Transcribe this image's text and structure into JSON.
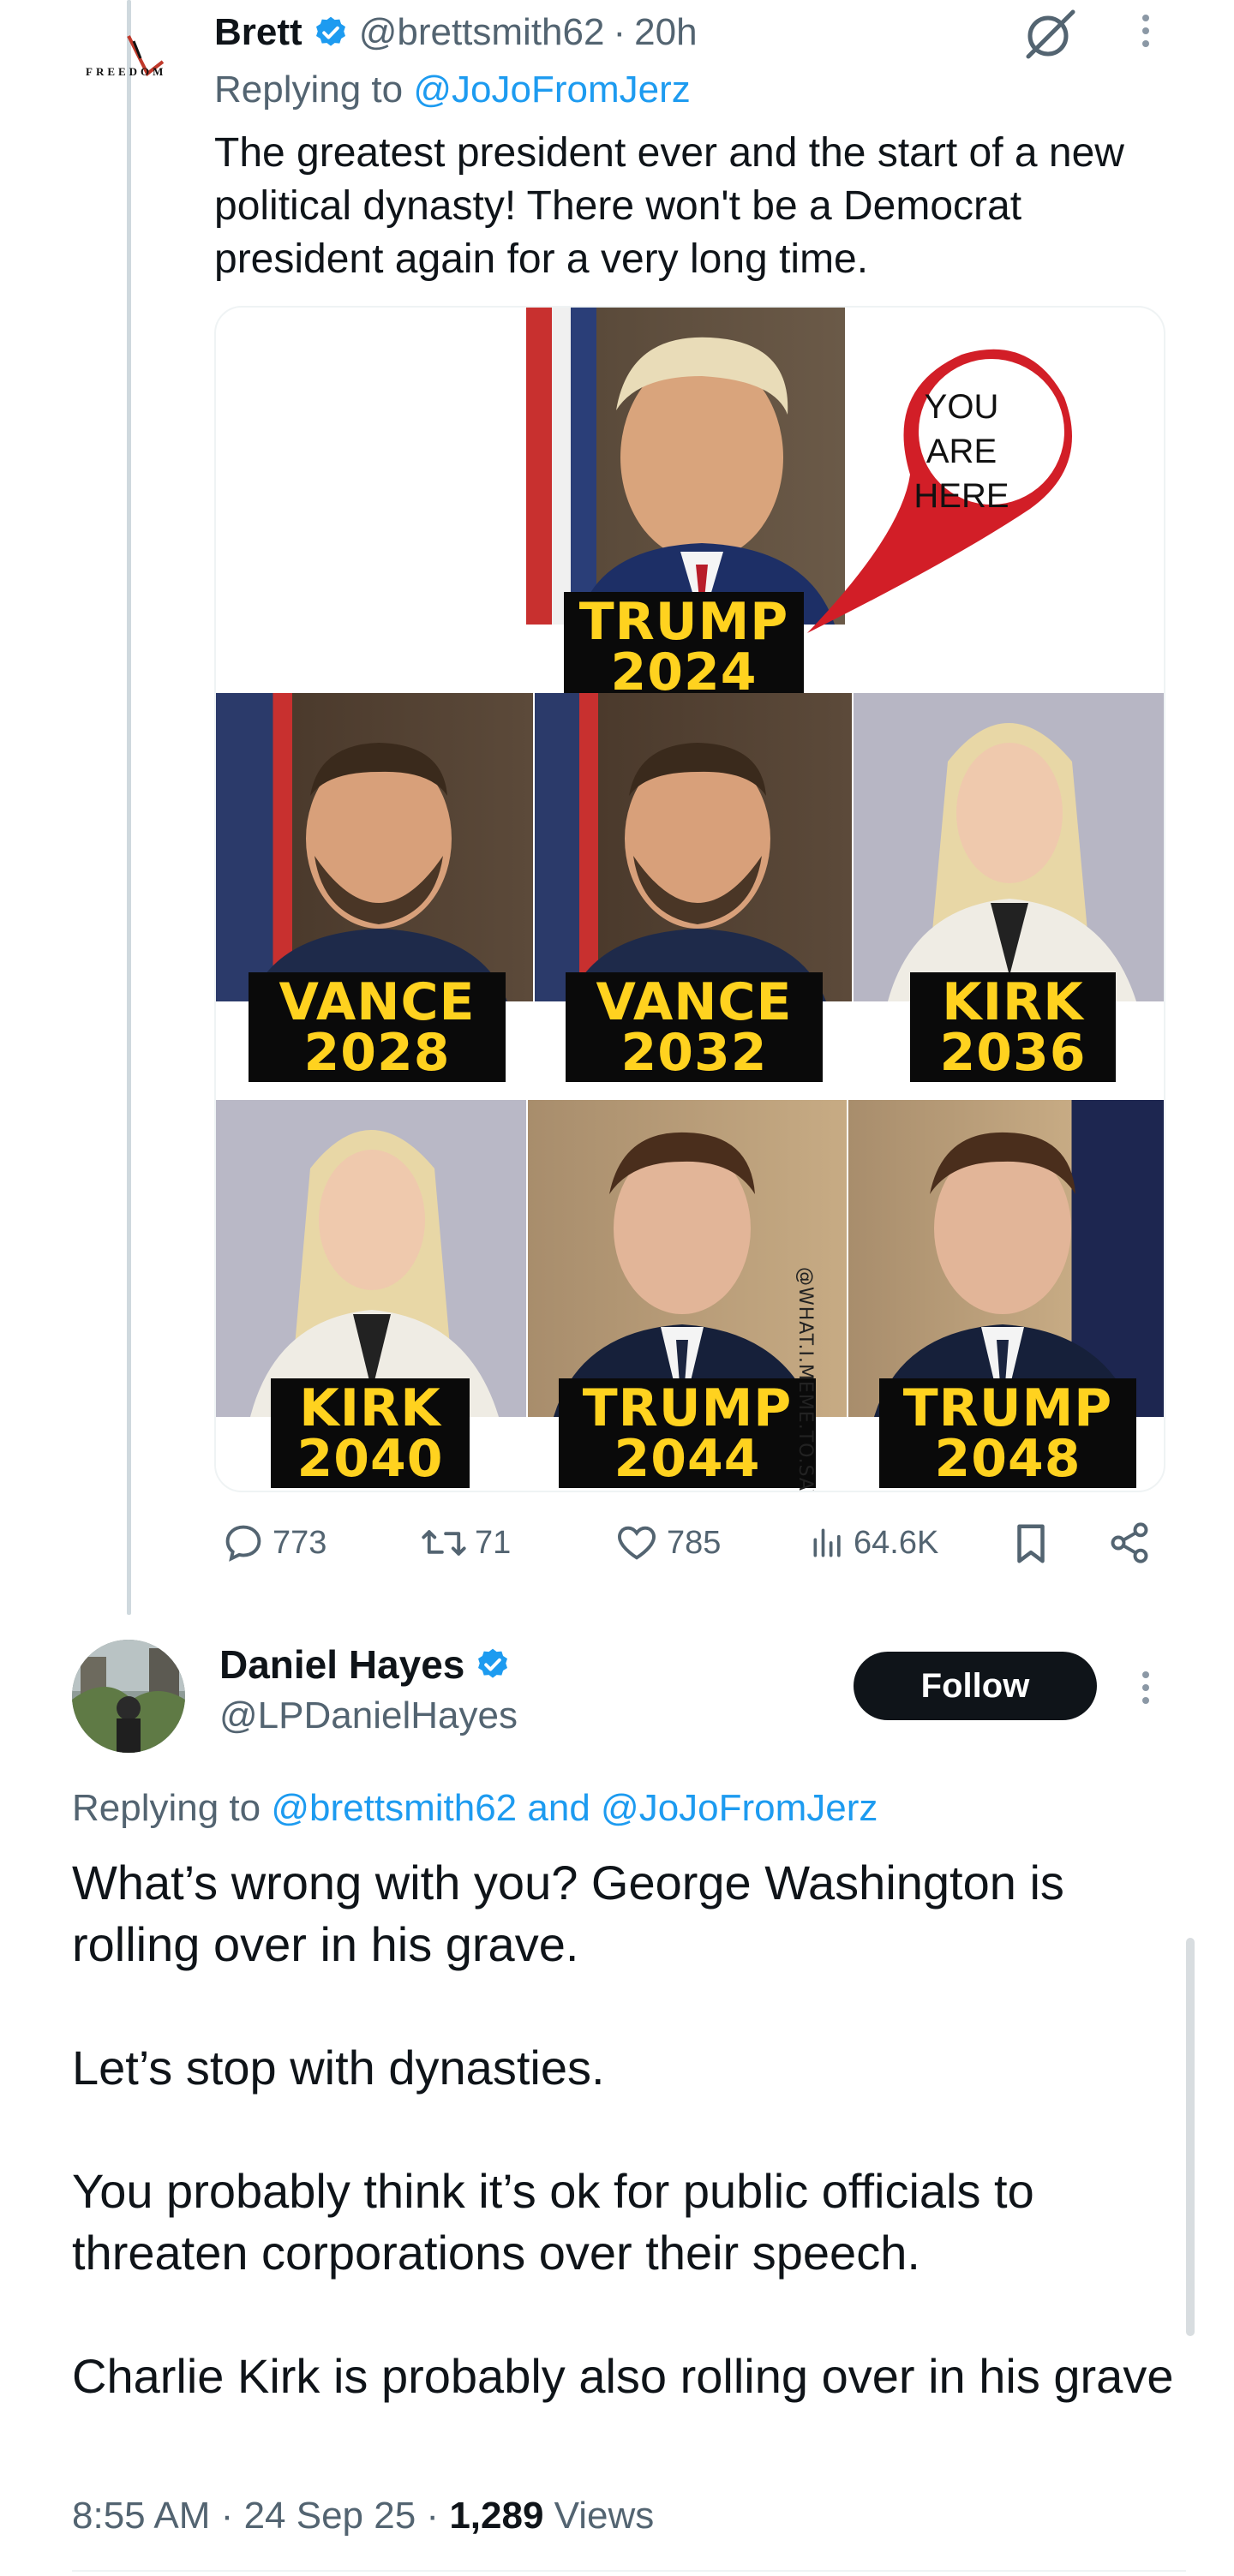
{
  "tweet1": {
    "avatar_text": "FREEDOM",
    "name": "Brett",
    "handle": "@brettsmith62",
    "time": "20h",
    "replying_prefix": "Replying to",
    "replying_to": "@JoJoFromJerz",
    "text": "The greatest president ever and the start of a new political dynasty! There won't be a Democrat president again for a very long time.",
    "meme": {
      "pin_text": "YOU\nARE\nHERE",
      "watermark": "@WHAT.I.MEME.TO.SAY",
      "labels": {
        "trump2024": "TRUMP\n2024",
        "vance2028": "VANCE\n2028",
        "vance2032": "VANCE\n2032",
        "kirk2036": "KIRK\n2036",
        "kirk2040": "KIRK\n2040",
        "trump2044": "TRUMP\n2044",
        "trump2048": "TRUMP\n2048"
      },
      "label_color": "#ffd21f"
    },
    "stats": {
      "replies": "773",
      "retweets": "71",
      "likes": "785",
      "views": "64.6K"
    }
  },
  "tweet2": {
    "name": "Daniel Hayes",
    "handle": "@LPDanielHayes",
    "follow_label": "Follow",
    "replying_prefix": "Replying to",
    "replying_to_1": "@brettsmith62",
    "replying_and": "and",
    "replying_to_2": "@JoJoFromJerz",
    "paragraphs": [
      "What’s wrong with you? George Washington is rolling over in his grave.",
      "Let’s stop with dynasties.",
      "You probably think it’s ok for public officials to threaten corporations over their speech.",
      "Charlie Kirk is probably also rolling over in his grave"
    ],
    "time": "8:55 AM",
    "date": "24 Sep 25",
    "views_count": "1,289",
    "views_label": "Views"
  },
  "colors": {
    "accent": "#1d9bf0",
    "secondary_text": "#536471",
    "primary_text": "#0f1419"
  }
}
